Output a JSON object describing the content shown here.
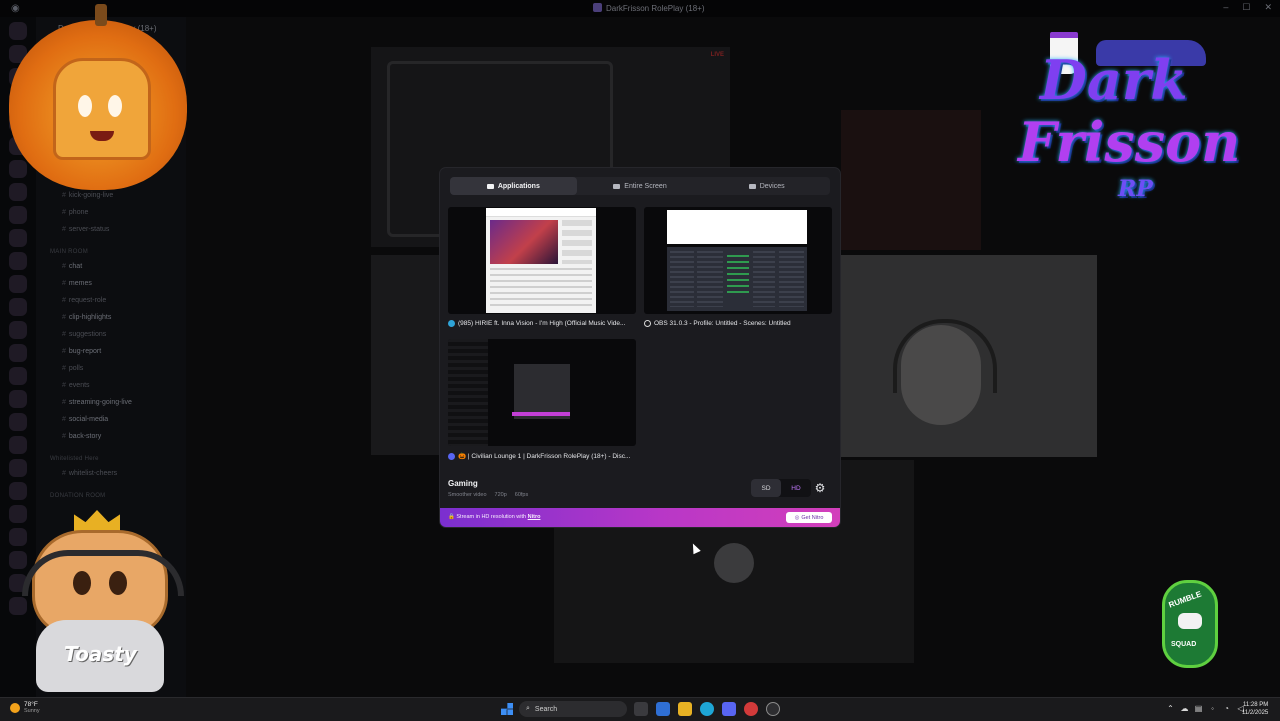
{
  "window": {
    "title": "DarkFrisson RolePlay (18+)"
  },
  "sidebar": {
    "server_name": "DarkFrisson RolePlay (18+)",
    "channels": [
      {
        "name": "kick-going-live",
        "top": 0
      },
      {
        "name": "phone"
      },
      {
        "name": "server-status"
      },
      {
        "name": "chat"
      },
      {
        "name": "memes"
      },
      {
        "name": "request-role"
      },
      {
        "name": "clip-highlights"
      },
      {
        "name": "suggestions"
      },
      {
        "name": "bug-report"
      },
      {
        "name": "polls"
      },
      {
        "name": "events"
      },
      {
        "name": "streaming-going-live"
      },
      {
        "name": "social-media"
      },
      {
        "name": "back-story"
      },
      {
        "name": "whitelist-cheers"
      }
    ],
    "categories": [
      "MAIN ROOM",
      "Whitelisted Here",
      "DONATION ROOM"
    ]
  },
  "live_label": "LIVE",
  "modal": {
    "tabs": [
      {
        "label": "Applications",
        "active": true
      },
      {
        "label": "Entire Screen",
        "active": false
      },
      {
        "label": "Devices",
        "active": false
      }
    ],
    "sources": [
      {
        "label": "(985) HIRIE ft. Inna Vision - I'm High (Official Music Vide...",
        "icon": "edge-icon",
        "icon_color": "#2fa4d8"
      },
      {
        "label": "OBS 31.0.3 - Profile: Untitled - Scenes: Untitled",
        "icon": "obs-icon",
        "icon_color": "#d7d7d7"
      },
      {
        "label": "🎃 | Civilian Lounge 1 | DarkFrisson RolePlay (18+) - Disc...",
        "icon": "discord-icon",
        "icon_color": "#5865f2"
      }
    ],
    "preset": {
      "title": "Gaming",
      "subtitle": "Smoother video",
      "resolution": "720p",
      "fps": "60fps"
    },
    "quality": {
      "sd": "SD",
      "hd": "HD",
      "selected": "SD"
    },
    "nitro": {
      "text": "Stream in HD resolution with",
      "link": "Nitro",
      "button": "Get Nitro"
    }
  },
  "overlay": {
    "logo_line1": "Dark",
    "logo_line2": "Frisson",
    "logo_line3": "RP",
    "mascot_name": "Toasty",
    "badge_top": "RUMBLE",
    "badge_bottom": "SQUAD"
  },
  "taskbar": {
    "weather_temp": "78°F",
    "weather_cond": "Sunny",
    "search_placeholder": "Search",
    "time": "11:28 PM",
    "date": "11/2/2025"
  },
  "colors": {
    "accent_purple": "#b837c7",
    "nitro_gradient_start": "#7b2fcf"
  }
}
